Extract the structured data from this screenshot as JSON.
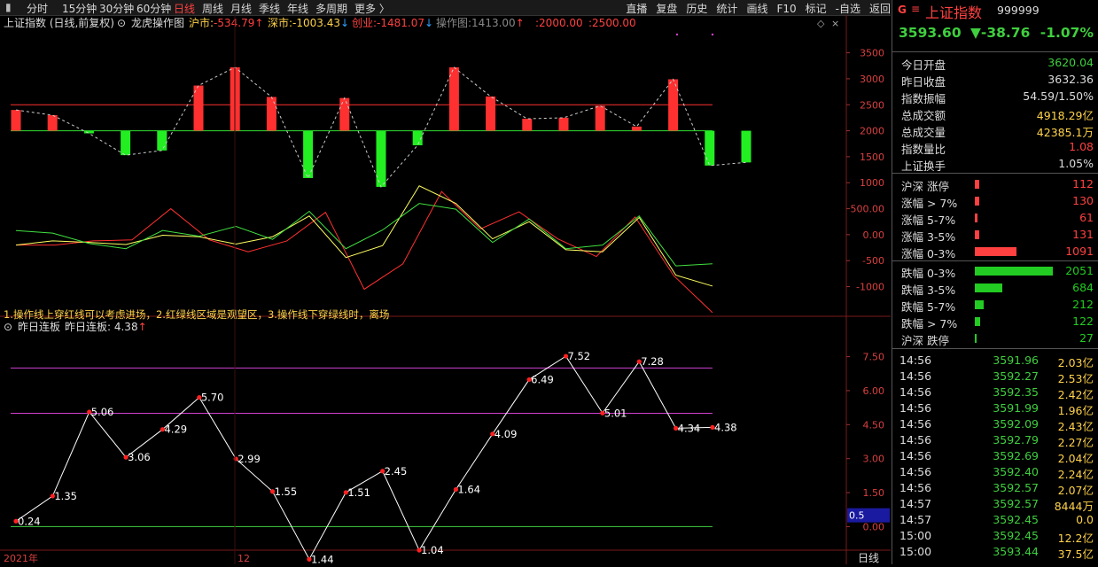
{
  "topbar": {
    "periods": [
      "分时",
      "15分钟",
      "30分钟",
      "60分钟",
      "日线",
      "周线",
      "月线",
      "季线",
      "年线",
      "多周期",
      "更多 〉"
    ],
    "active_index": 4,
    "tools": [
      "直播",
      "复盘",
      "历史",
      "统计",
      "画线",
      "F10",
      "标记",
      "-自选",
      "返回"
    ]
  },
  "chart_header": {
    "title": "上证指数 (日线,前复权)",
    "indicator": "龙虎操作图",
    "items": [
      {
        "label": "沪市:",
        "value": "-534.79",
        "arrow": "↑",
        "color": "#ffd24a",
        "vcolor": "#ff4040"
      },
      {
        "label": "深市:",
        "value": "-1003.43",
        "arrow": "↓",
        "color": "#ffd24a",
        "vcolor": "#ffd24a"
      },
      {
        "label": "创业:",
        "value": "-1481.07",
        "arrow": "↓",
        "color": "#ff4040",
        "vcolor": "#ff4040"
      },
      {
        "label": "操作图:",
        "value": "1413.00",
        "arrow": "↑",
        "color": "#888888",
        "vcolor": "#888888"
      },
      {
        "label": ":",
        "value": "2000.00",
        "arrow": "",
        "color": "#ff4040",
        "vcolor": "#ff4040"
      },
      {
        "label": ":",
        "value": "2500.00",
        "arrow": "",
        "color": "#ff4040",
        "vcolor": "#ff4040"
      }
    ],
    "note": "1.操作线上穿红线可以考虑进场，2.红绿线区域是观望区，3.操作线下穿绿线时，离场"
  },
  "chart_data": [
    {
      "type": "bar",
      "title": "龙虎操作图",
      "baseline": 2000,
      "upper_line": 2500,
      "ylim": [
        -1400,
        3800
      ],
      "yticks": [
        "3500",
        "3000",
        "2500",
        "2000",
        "1500",
        "1000",
        "500.00",
        "0.00",
        "-500",
        "-1000"
      ],
      "bars": [
        2400,
        2300,
        1950,
        1530,
        1620,
        2870,
        3220,
        2650,
        1090,
        2630,
        920,
        1720,
        3220,
        2660,
        2230,
        2250,
        2480,
        2080,
        2990,
        1330,
        1390
      ],
      "series": [
        {
          "color": "#ff3030",
          "values": [
            -200,
            -200,
            -120,
            -100,
            500,
            -100,
            -330,
            -120,
            430,
            -1050,
            -560,
            830,
            110,
            440,
            -80,
            -420,
            340,
            -790,
            -1500
          ]
        },
        {
          "color": "#ffff60",
          "values": [
            -200,
            -120,
            -150,
            -190,
            -10,
            -40,
            -180,
            -40,
            360,
            -440,
            -210,
            940,
            600,
            -80,
            250,
            -290,
            -330,
            330,
            -780,
            -990
          ]
        },
        {
          "color": "#40e040",
          "values": [
            80,
            30,
            -170,
            -270,
            80,
            -30,
            160,
            -90,
            450,
            -270,
            90,
            600,
            490,
            -150,
            300,
            -270,
            -200,
            360,
            -600,
            -560
          ]
        }
      ]
    },
    {
      "type": "line",
      "title": "昨日连板",
      "header_label": "昨日连板:",
      "header_value": "4.38",
      "ylim": [
        -1,
        8.5
      ],
      "yticks": [
        "7.50",
        "6.00",
        "4.50",
        "3.00",
        "1.50",
        "0.00"
      ],
      "hlines": [
        {
          "y": 7,
          "color": "#d040d0"
        },
        {
          "y": 5,
          "color": "#d040d0"
        },
        {
          "y": 0,
          "color": "#40d040"
        }
      ],
      "values": [
        0.24,
        1.35,
        5.06,
        3.06,
        4.29,
        5.7,
        2.99,
        1.55,
        -1.44,
        1.51,
        2.45,
        -1.04,
        1.64,
        4.09,
        6.49,
        7.52,
        5.01,
        7.28,
        4.34,
        4.38
      ],
      "labels": [
        "0.24",
        "1.35",
        "5.06",
        "3.06",
        "4.29",
        "5.70",
        "2.99",
        "1.55",
        "1.44",
        "1.51",
        "2.45",
        "1.04",
        "1.64",
        "4.09",
        "6.49",
        "7.52",
        "5.01",
        "7.28",
        "4.34",
        "4.38"
      ],
      "cursor_value": "0.5"
    }
  ],
  "xaxis": {
    "year_label": "2021年",
    "month_label": "12",
    "period_label": "日线"
  },
  "panel": {
    "icon_text": "G",
    "name": "上证指数",
    "code": "999999",
    "price": "3593.60",
    "change": "▼-38.76",
    "pct": "-1.07%",
    "stats": [
      {
        "k": "今日开盘",
        "v": "3620.04",
        "c": "#3fcf3f"
      },
      {
        "k": "昨日收盘",
        "v": "3632.36",
        "c": "#dcdcdc"
      },
      {
        "k": "指数振幅",
        "v": "54.59/1.50%",
        "c": "#dcdcdc"
      },
      {
        "k": "总成交额",
        "v": "4918.29亿",
        "c": "#ffd24a"
      },
      {
        "k": "总成交量",
        "v": "42385.1万",
        "c": "#ffd24a"
      },
      {
        "k": "指数量比",
        "v": "1.08",
        "c": "#ff4040"
      },
      {
        "k": "上证换手",
        "v": "1.05%",
        "c": "#dcdcdc"
      }
    ],
    "rise": [
      {
        "k": "沪深 涨停",
        "v": "112",
        "frac": 0.06
      },
      {
        "k": "涨幅 > 7%",
        "v": "130",
        "frac": 0.06
      },
      {
        "k": "涨幅 5-7%",
        "v": "61",
        "frac": 0.03
      },
      {
        "k": "涨幅 3-5%",
        "v": "131",
        "frac": 0.06
      },
      {
        "k": "涨幅 0-3%",
        "v": "1091",
        "frac": 0.53
      }
    ],
    "fall": [
      {
        "k": "跌幅 0-3%",
        "v": "2051",
        "frac": 1.0
      },
      {
        "k": "跌幅 3-5%",
        "v": "684",
        "frac": 0.35
      },
      {
        "k": "跌幅 5-7%",
        "v": "212",
        "frac": 0.11
      },
      {
        "k": "跌幅 > 7%",
        "v": "122",
        "frac": 0.07
      },
      {
        "k": "沪深 跌停",
        "v": "27",
        "frac": 0.015
      }
    ],
    "ticks": [
      {
        "t": "14:56",
        "p": "3591.96",
        "a": "2.03亿"
      },
      {
        "t": "14:56",
        "p": "3592.27",
        "a": "2.53亿"
      },
      {
        "t": "14:56",
        "p": "3592.35",
        "a": "2.42亿"
      },
      {
        "t": "14:56",
        "p": "3591.99",
        "a": "1.96亿"
      },
      {
        "t": "14:56",
        "p": "3592.09",
        "a": "2.43亿"
      },
      {
        "t": "14:56",
        "p": "3592.79",
        "a": "2.27亿"
      },
      {
        "t": "14:56",
        "p": "3592.69",
        "a": "2.04亿"
      },
      {
        "t": "14:56",
        "p": "3592.40",
        "a": "2.24亿"
      },
      {
        "t": "14:56",
        "p": "3592.57",
        "a": "2.07亿"
      },
      {
        "t": "14:57",
        "p": "3592.57",
        "a": "8444万"
      },
      {
        "t": "14:57",
        "p": "3592.45",
        "a": "0.0"
      },
      {
        "t": "15:00",
        "p": "3592.45",
        "a": "12.2亿"
      },
      {
        "t": "15:00",
        "p": "3593.44",
        "a": "37.5亿"
      }
    ]
  },
  "colors": {
    "up": "#ff3030",
    "down": "#22ee22",
    "line": "#ffffff",
    "text": "#dcdcdc"
  }
}
